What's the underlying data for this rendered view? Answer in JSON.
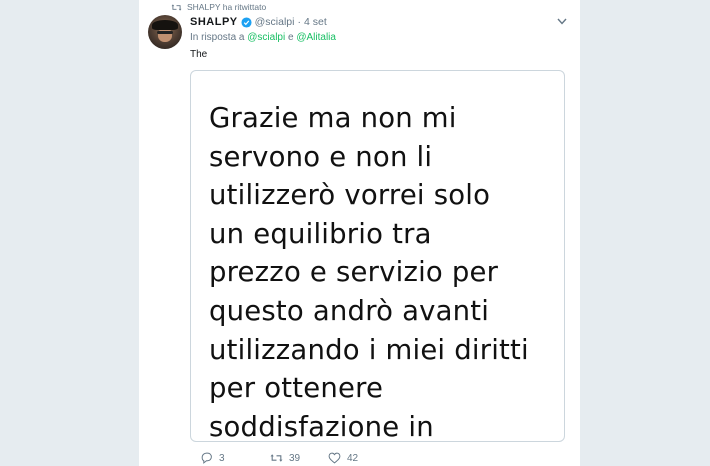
{
  "retweet_header": {
    "text": "SHALPY ha ritwittato"
  },
  "tweet": {
    "author_name": "SHALPY",
    "handle": "@scialpi",
    "separator": "·",
    "time": "4 set",
    "reply_prefix": "In risposta a",
    "reply_user_1": "@scialpi",
    "reply_connector": "e",
    "reply_user_2": "@Alitalia",
    "text": "The",
    "image_text": "Grazie ma non mi\nservono e non li\nutilizzerò vorrei solo\nun equilibrio tra\nprezzo e servizio per\nquesto andrò avanti\nutilizzando i miei diritti\nper ottenere\nsoddisfazione in",
    "actions": {
      "replies": "3",
      "retweets": "39",
      "likes": "42"
    }
  },
  "colors": {
    "link_blue": "#1da1f2",
    "mention_green": "#17bf63",
    "verified_blue": "#1da1f2",
    "muted": "#657786"
  },
  "icons": {
    "retweet": "retweet-icon",
    "verified": "verified-badge-icon",
    "menu": "chevron-down-icon",
    "reply": "reply-icon",
    "like": "heart-icon"
  }
}
